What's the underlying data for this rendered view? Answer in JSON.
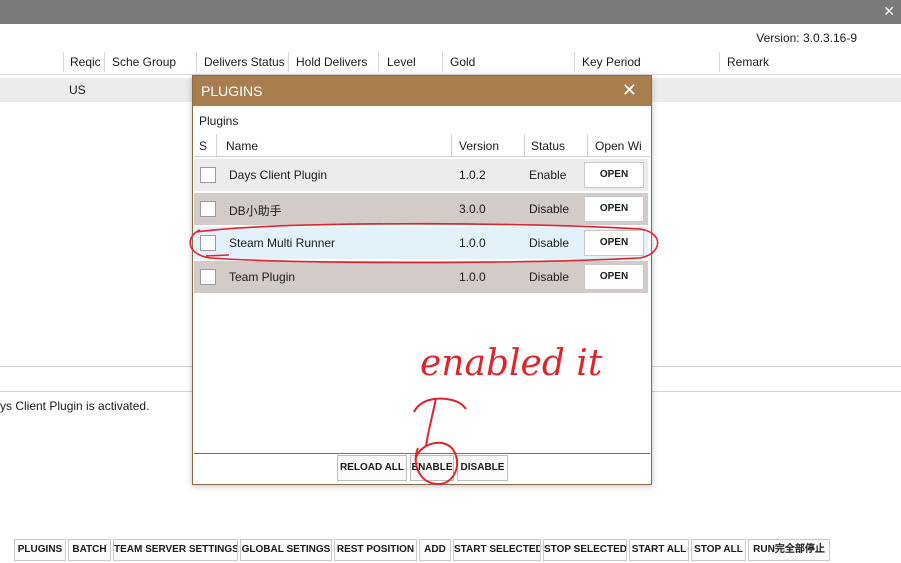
{
  "app": {
    "version": "Version: 3.0.3.16-9"
  },
  "table": {
    "columns": [
      "Reqic",
      "Sche Group",
      "Delivers Status",
      "Hold Delivers",
      "Level",
      "Gold",
      "Key Period",
      "Remark"
    ],
    "row_region": "US"
  },
  "log": {
    "message": "ys Client Plugin is activated."
  },
  "toolbar": {
    "buttons": [
      "PLUGINS",
      "BATCH",
      "TEAM SERVER SETTINGS",
      "GLOBAL SETINGS",
      "REST POSITION",
      "ADD",
      "START SELECTED",
      "STOP SELECTED",
      "START ALL",
      "STOP ALL",
      "RUN完全部停止"
    ]
  },
  "dialog": {
    "title": "PLUGINS",
    "section_label": "Plugins",
    "columns": {
      "s": "S",
      "name": "Name",
      "version": "Version",
      "status": "Status",
      "open": "Open Wi"
    },
    "plugins": [
      {
        "name": "Days Client Plugin",
        "version": "1.0.2",
        "status": "Enable",
        "action": "OPEN",
        "bg": "#ececec"
      },
      {
        "name": "DB小助手",
        "version": "3.0.0",
        "status": "Disable",
        "action": "OPEN",
        "bg": "#d3cbc8"
      },
      {
        "name": "Steam Multi Runner",
        "version": "1.0.0",
        "status": "Disable",
        "action": "OPEN",
        "bg": "#e3f1fa"
      },
      {
        "name": "Team Plugin",
        "version": "1.0.0",
        "status": "Disable",
        "action": "OPEN",
        "bg": "#d3cbc8"
      }
    ],
    "buttons": {
      "reload": "RELOAD ALL",
      "enable": "ENABLE",
      "disable": "DISABLE"
    }
  },
  "annotation": {
    "text": "enabled it",
    "color": "#e0242c"
  },
  "colors": {
    "dialog_title_bg": "#a97e4f",
    "titlebar_bg": "#7a7a7a"
  }
}
